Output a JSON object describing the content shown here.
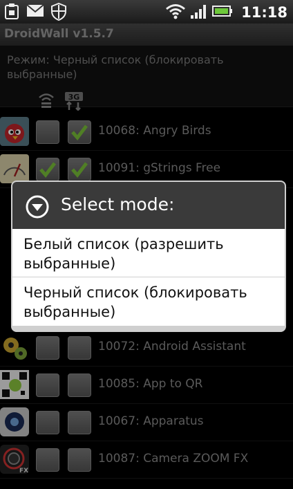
{
  "status_bar": {
    "left_icons": [
      "clipboard-icon",
      "mail-icon",
      "shield-icon"
    ],
    "right_icons": [
      "wifi-icon",
      "signal-icon",
      "battery-icon"
    ],
    "time": "11:18"
  },
  "app": {
    "title": "DroidWall v1.5.7",
    "mode_text": "Режим: Черный список (блокировать выбранные)"
  },
  "column_icons": [
    "wifi-icon",
    "3g-icon"
  ],
  "apps": [
    {
      "label": "10068: Angry Birds",
      "icon": "angry-birds-icon",
      "wifi": false,
      "data": true
    },
    {
      "label": "10091: gStrings Free",
      "icon": "gstrings-icon",
      "wifi": true,
      "data": true
    },
    {
      "label": "10072: Android Assistant",
      "icon": "gears-icon",
      "wifi": false,
      "data": false
    },
    {
      "label": "10085: App to QR",
      "icon": "qr-icon",
      "wifi": false,
      "data": false
    },
    {
      "label": "10067: Apparatus",
      "icon": "apparatus-icon",
      "wifi": false,
      "data": false
    },
    {
      "label": "10087: Camera ZOOM FX",
      "icon": "camera-icon",
      "wifi": false,
      "data": false
    }
  ],
  "dialog": {
    "title": "Select mode:",
    "options": [
      "Белый список (разрешить выбранные)",
      "Черный список (блокировать выбранные)"
    ]
  },
  "colors": {
    "check_green": "#7cc43a",
    "dialog_header": "#3a3a3a",
    "dialog_body": "#ffffff"
  }
}
